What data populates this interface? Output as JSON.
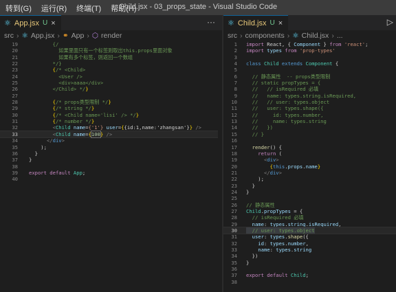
{
  "titlebar": {
    "menus": [
      "转到(G)",
      "运行(R)",
      "终端(T)",
      "帮助(H)"
    ],
    "title": "Child.jsx - 03_props_state - Visual Studio Code"
  },
  "left": {
    "tab": {
      "name": "App.jsx",
      "status": "U",
      "close": "×"
    },
    "more": "···",
    "breadcrumb": [
      "src",
      "App.jsx",
      "App",
      "render"
    ],
    "lines": [
      [
        19,
        [
          [
            "c",
            "        {/"
          ]
        ]
      ],
      [
        20,
        [
          [
            "c",
            "          如果里面只有一个标签则取出this.props里面对象"
          ]
        ]
      ],
      [
        21,
        [
          [
            "c",
            "          如果有多个标签，则返回一个数组"
          ]
        ]
      ],
      [
        22,
        [
          [
            "c",
            "        */}"
          ]
        ]
      ],
      [
        23,
        [
          [
            "y",
            "        {"
          ],
          [
            "c",
            "/* <Child>"
          ]
        ]
      ],
      [
        24,
        [
          [
            "c",
            "          <User />"
          ]
        ]
      ],
      [
        25,
        [
          [
            "c",
            "          <div>aaaa</div>"
          ]
        ]
      ],
      [
        26,
        [
          [
            "c",
            "        </Child> */"
          ],
          [
            "y",
            "}"
          ]
        ]
      ],
      [
        27,
        [
          [
            "w",
            ""
          ]
        ]
      ],
      [
        28,
        [
          [
            "y",
            "        {"
          ],
          [
            "c",
            "/* props类型限制 */"
          ],
          [
            "y",
            "}"
          ]
        ]
      ],
      [
        29,
        [
          [
            "y",
            "        {"
          ],
          [
            "c",
            "/* string */"
          ],
          [
            "y",
            "}"
          ]
        ]
      ],
      [
        30,
        [
          [
            "y",
            "        {"
          ],
          [
            "c",
            "/* <Child name='lisi' /> */"
          ],
          [
            "y",
            "}"
          ]
        ]
      ],
      [
        31,
        [
          [
            "y",
            "        {"
          ],
          [
            "c",
            "/* number */"
          ],
          [
            "y",
            "}"
          ]
        ]
      ],
      [
        32,
        [
          [
            "p",
            "        <"
          ],
          [
            "t",
            "Child"
          ],
          [
            "v",
            " name"
          ],
          [
            "w",
            "="
          ],
          [
            "s",
            "{'1'}"
          ],
          [
            "v",
            " user"
          ],
          [
            "w",
            "="
          ],
          [
            "y",
            "{"
          ],
          [
            "w",
            "{id:1,name:'zhangsan'}"
          ],
          [
            "y",
            "}"
          ],
          [
            "p",
            " />"
          ]
        ]
      ],
      [
        33,
        [
          [
            "p",
            "        <"
          ],
          [
            "t",
            "Child"
          ],
          [
            "v",
            " name"
          ],
          [
            "w",
            "="
          ],
          [
            "y",
            "{"
          ],
          [
            "n",
            "100"
          ],
          [
            "y",
            "}"
          ],
          [
            "p",
            " />"
          ]
        ]
      ],
      [
        34,
        [
          [
            "p",
            "      </"
          ],
          [
            "tag",
            "div"
          ],
          [
            "p",
            ">"
          ]
        ]
      ],
      [
        35,
        [
          [
            "w",
            "    );"
          ]
        ]
      ],
      [
        36,
        [
          [
            "w",
            "  }"
          ]
        ]
      ],
      [
        37,
        [
          [
            "w",
            "}"
          ]
        ]
      ],
      [
        38,
        [
          [
            "w",
            ""
          ]
        ]
      ],
      [
        39,
        [
          [
            "kc",
            "export"
          ],
          [
            "w",
            " "
          ],
          [
            "kc",
            "default"
          ],
          [
            "w",
            " "
          ],
          [
            "t",
            "App"
          ],
          [
            "w",
            ";"
          ]
        ]
      ],
      [
        40,
        [
          [
            "w",
            ""
          ]
        ]
      ]
    ]
  },
  "right": {
    "tab": {
      "name": "Child.jsx",
      "status": "U",
      "close": "×"
    },
    "run": "▷",
    "breadcrumb": [
      "src",
      "components",
      "Child.jsx",
      "..."
    ],
    "lines": [
      [
        1,
        [
          [
            "kc",
            "import"
          ],
          [
            "w",
            " React, { "
          ],
          [
            "v",
            "Component"
          ],
          [
            "w",
            " } "
          ],
          [
            "kc",
            "from"
          ],
          [
            "s",
            " 'react'"
          ],
          [
            "w",
            ";"
          ]
        ]
      ],
      [
        2,
        [
          [
            "kc",
            "import"
          ],
          [
            "w",
            " "
          ],
          [
            "v",
            "types"
          ],
          [
            "w",
            " "
          ],
          [
            "kc",
            "from"
          ],
          [
            "s",
            " 'prop-types'"
          ]
        ]
      ],
      [
        3,
        [
          [
            "w",
            ""
          ]
        ]
      ],
      [
        4,
        [
          [
            "k",
            "class"
          ],
          [
            "t",
            " Child"
          ],
          [
            "k",
            " extends"
          ],
          [
            "t",
            " Component"
          ],
          [
            "w",
            " {"
          ]
        ]
      ],
      [
        5,
        [
          [
            "w",
            ""
          ]
        ]
      ],
      [
        6,
        [
          [
            "c",
            "  // 静态属性  -- props类型限制"
          ]
        ]
      ],
      [
        7,
        [
          [
            "c",
            "  // static propTypes = {"
          ]
        ]
      ],
      [
        8,
        [
          [
            "c",
            "  //   // isRequired 必填"
          ]
        ]
      ],
      [
        9,
        [
          [
            "c",
            "  //   name: types.string.isRequired,"
          ]
        ]
      ],
      [
        10,
        [
          [
            "c",
            "  //   // user: types.object"
          ]
        ]
      ],
      [
        11,
        [
          [
            "c",
            "  //   user: types.shape({"
          ]
        ]
      ],
      [
        12,
        [
          [
            "c",
            "  //     id: types.number,"
          ]
        ]
      ],
      [
        13,
        [
          [
            "c",
            "  //     name: types.string"
          ]
        ]
      ],
      [
        14,
        [
          [
            "c",
            "  //   })"
          ]
        ]
      ],
      [
        15,
        [
          [
            "c",
            "  // }"
          ]
        ]
      ],
      [
        16,
        [
          [
            "w",
            ""
          ]
        ]
      ],
      [
        17,
        [
          [
            "f",
            "  render"
          ],
          [
            "w",
            "() {"
          ]
        ]
      ],
      [
        18,
        [
          [
            "kc",
            "    return"
          ],
          [
            "w",
            " ("
          ]
        ]
      ],
      [
        19,
        [
          [
            "p",
            "      <"
          ],
          [
            "tag",
            "div"
          ],
          [
            "p",
            ">"
          ]
        ]
      ],
      [
        20,
        [
          [
            "y",
            "        {"
          ],
          [
            "k",
            "this"
          ],
          [
            "w",
            "."
          ],
          [
            "v",
            "props"
          ],
          [
            "w",
            "."
          ],
          [
            "v",
            "name"
          ],
          [
            "y",
            "}"
          ]
        ]
      ],
      [
        21,
        [
          [
            "p",
            "      </"
          ],
          [
            "tag",
            "div"
          ],
          [
            "p",
            ">"
          ]
        ]
      ],
      [
        22,
        [
          [
            "w",
            "    );"
          ]
        ]
      ],
      [
        23,
        [
          [
            "w",
            "  }"
          ]
        ]
      ],
      [
        24,
        [
          [
            "w",
            "}"
          ]
        ]
      ],
      [
        25,
        [
          [
            "w",
            ""
          ]
        ]
      ],
      [
        26,
        [
          [
            "c",
            "// 静态属性"
          ]
        ]
      ],
      [
        27,
        [
          [
            "t",
            "Child"
          ],
          [
            "w",
            "."
          ],
          [
            "v",
            "propTypes"
          ],
          [
            "w",
            " = {"
          ]
        ]
      ],
      [
        28,
        [
          [
            "c",
            "  // isRequired 必填"
          ]
        ]
      ],
      [
        29,
        [
          [
            "v",
            "  name"
          ],
          [
            "w",
            ": "
          ],
          [
            "v",
            "types"
          ],
          [
            "w",
            "."
          ],
          [
            "v",
            "string"
          ],
          [
            "w",
            "."
          ],
          [
            "v",
            "isRequired"
          ],
          [
            "w",
            ","
          ]
        ]
      ],
      [
        30,
        [
          [
            "c",
            "  // user: types.object"
          ]
        ]
      ],
      [
        31,
        [
          [
            "v",
            "  user"
          ],
          [
            "w",
            ": "
          ],
          [
            "v",
            "types"
          ],
          [
            "w",
            "."
          ],
          [
            "f",
            "shape"
          ],
          [
            "w",
            "({"
          ]
        ]
      ],
      [
        32,
        [
          [
            "v",
            "    id"
          ],
          [
            "w",
            ": "
          ],
          [
            "v",
            "types"
          ],
          [
            "w",
            "."
          ],
          [
            "v",
            "number"
          ],
          [
            "w",
            ","
          ]
        ]
      ],
      [
        33,
        [
          [
            "v",
            "    name"
          ],
          [
            "w",
            ": "
          ],
          [
            "v",
            "types"
          ],
          [
            "w",
            "."
          ],
          [
            "v",
            "string"
          ]
        ]
      ],
      [
        34,
        [
          [
            "w",
            "  })"
          ]
        ]
      ],
      [
        35,
        [
          [
            "w",
            "}"
          ]
        ]
      ],
      [
        36,
        [
          [
            "w",
            ""
          ]
        ]
      ],
      [
        37,
        [
          [
            "kc",
            "export"
          ],
          [
            "w",
            " "
          ],
          [
            "kc",
            "default"
          ],
          [
            "w",
            " "
          ],
          [
            "t",
            "Child"
          ],
          [
            "w",
            ";"
          ]
        ]
      ],
      [
        38,
        [
          [
            "w",
            ""
          ]
        ]
      ]
    ]
  },
  "colors": {
    "accent": "#0e639c",
    "react": "#61dafb",
    "untracked": "#73c991"
  }
}
